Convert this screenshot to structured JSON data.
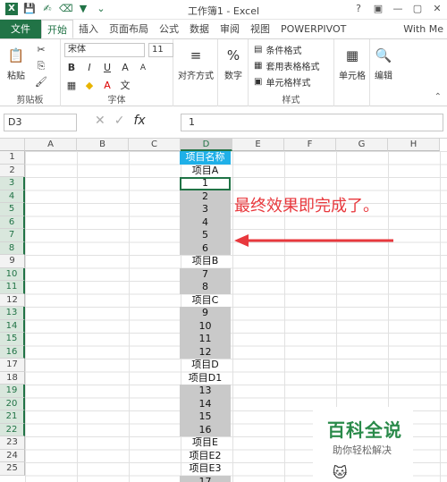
{
  "title": "工作簿1 - Excel",
  "quick_access": [
    "save-icon",
    "touch-icon",
    "eraser-icon",
    "filter-icon",
    "more-icon"
  ],
  "window_controls": [
    "?",
    "▣",
    "—",
    "▢",
    "✕"
  ],
  "tabs": {
    "file": "文件",
    "items": [
      "开始",
      "插入",
      "页面布局",
      "公式",
      "数据",
      "审阅",
      "视图",
      "POWERPIVOT"
    ],
    "user": "With Me"
  },
  "ribbon": {
    "paste": "粘贴",
    "clipboard_group": "剪贴板",
    "font_name": "宋体",
    "font_size": "11",
    "font_group": "字体",
    "align": "对齐方式",
    "number": "数字",
    "cond_format": "条件格式",
    "table_format": "套用表格格式",
    "cell_style": "单元格样式",
    "style_group": "样式",
    "cells": "单元格",
    "edit": "编辑"
  },
  "formula_bar": {
    "name_box": "D3",
    "fx": "fx",
    "value": "1"
  },
  "columns": [
    "A",
    "B",
    "C",
    "D",
    "E",
    "F",
    "G",
    "H"
  ],
  "rows": [
    "1",
    "2",
    "3",
    "4",
    "5",
    "6",
    "7",
    "8",
    "9",
    "10",
    "11",
    "12",
    "13",
    "14",
    "15",
    "16",
    "17",
    "18",
    "19",
    "20",
    "21",
    "22",
    "23",
    "24",
    "25"
  ],
  "column_d": [
    {
      "text": "项目名称",
      "style": "hdr"
    },
    {
      "text": "项目A",
      "style": "plain"
    },
    {
      "text": "1",
      "style": "active"
    },
    {
      "text": "2",
      "style": "gray"
    },
    {
      "text": "3",
      "style": "gray"
    },
    {
      "text": "4",
      "style": "gray"
    },
    {
      "text": "5",
      "style": "gray"
    },
    {
      "text": "6",
      "style": "gray"
    },
    {
      "text": "项目B",
      "style": "plain"
    },
    {
      "text": "7",
      "style": "gray"
    },
    {
      "text": "8",
      "style": "gray"
    },
    {
      "text": "项目C",
      "style": "plain"
    },
    {
      "text": "9",
      "style": "gray"
    },
    {
      "text": "10",
      "style": "gray"
    },
    {
      "text": "11",
      "style": "gray"
    },
    {
      "text": "12",
      "style": "gray"
    },
    {
      "text": "项目D",
      "style": "plain"
    },
    {
      "text": "项目D1",
      "style": "plain"
    },
    {
      "text": "13",
      "style": "gray"
    },
    {
      "text": "14",
      "style": "gray"
    },
    {
      "text": "15",
      "style": "gray"
    },
    {
      "text": "16",
      "style": "gray"
    },
    {
      "text": "项目E",
      "style": "plain"
    },
    {
      "text": "项目E2",
      "style": "plain"
    },
    {
      "text": "项目E3",
      "style": "plain"
    },
    {
      "text": "17",
      "style": "gray"
    }
  ],
  "selected_rows": [
    "3",
    "4",
    "5",
    "6",
    "7",
    "8",
    "10",
    "11",
    "13",
    "14",
    "15",
    "16",
    "19",
    "20",
    "21",
    "22"
  ],
  "annotation": "最终效果即完成了。",
  "watermark": {
    "main": "百科全说",
    "sub": "助你轻松解决"
  },
  "colors": {
    "excel_green": "#217346",
    "header_blue": "#1fb0e8",
    "annotation_red": "#e8383d",
    "selected_gray": "#c9c9c9"
  }
}
